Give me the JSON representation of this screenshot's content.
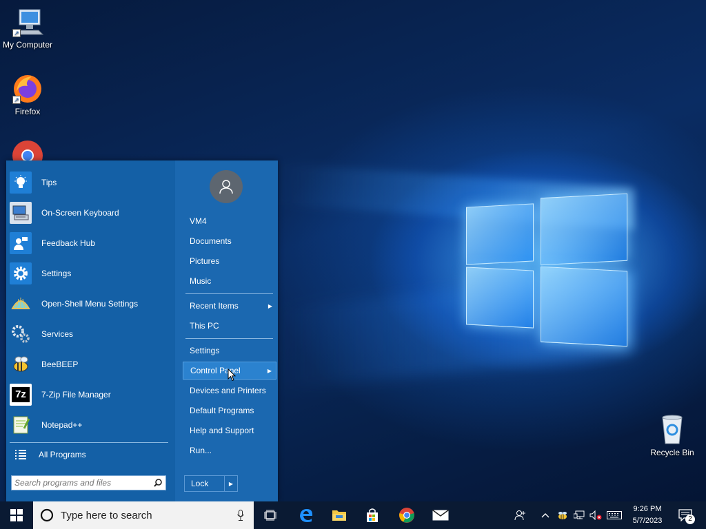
{
  "desktop": {
    "icons": [
      {
        "label": "My Computer"
      },
      {
        "label": "Firefox"
      },
      {
        "label": "Recycle Bin"
      }
    ]
  },
  "start_menu": {
    "programs": [
      {
        "label": "Tips",
        "icon": "lightbulb-icon"
      },
      {
        "label": "On-Screen Keyboard",
        "icon": "keyboard-icon"
      },
      {
        "label": "Feedback Hub",
        "icon": "feedback-icon"
      },
      {
        "label": "Settings",
        "icon": "gear-icon"
      },
      {
        "label": "Open-Shell Menu Settings",
        "icon": "shell-icon"
      },
      {
        "label": "Services",
        "icon": "gears-icon"
      },
      {
        "label": "BeeBEEP",
        "icon": "bee-icon"
      },
      {
        "label": "7-Zip File Manager",
        "icon": "7zip-icon"
      },
      {
        "label": "Notepad++",
        "icon": "notepad-icon"
      }
    ],
    "all_programs": "All Programs",
    "search_placeholder": "Search programs and files",
    "right": {
      "items_group1": [
        "VM4",
        "Documents",
        "Pictures",
        "Music"
      ],
      "items_group2": [
        "Recent Items",
        "This PC"
      ],
      "items_group3": [
        "Settings",
        "Control Panel",
        "Devices and Printers",
        "Default Programs",
        "Help and Support",
        "Run..."
      ],
      "lock_label": "Lock"
    }
  },
  "taskbar": {
    "search_placeholder": "Type here to search",
    "time": "9:26 PM",
    "date": "5/7/2023",
    "notification_count": "2"
  },
  "colors": {
    "start_menu_bg": "#1460a6",
    "taskbar_bg": "#0a1a33",
    "selected_item": "#2b82cf"
  }
}
